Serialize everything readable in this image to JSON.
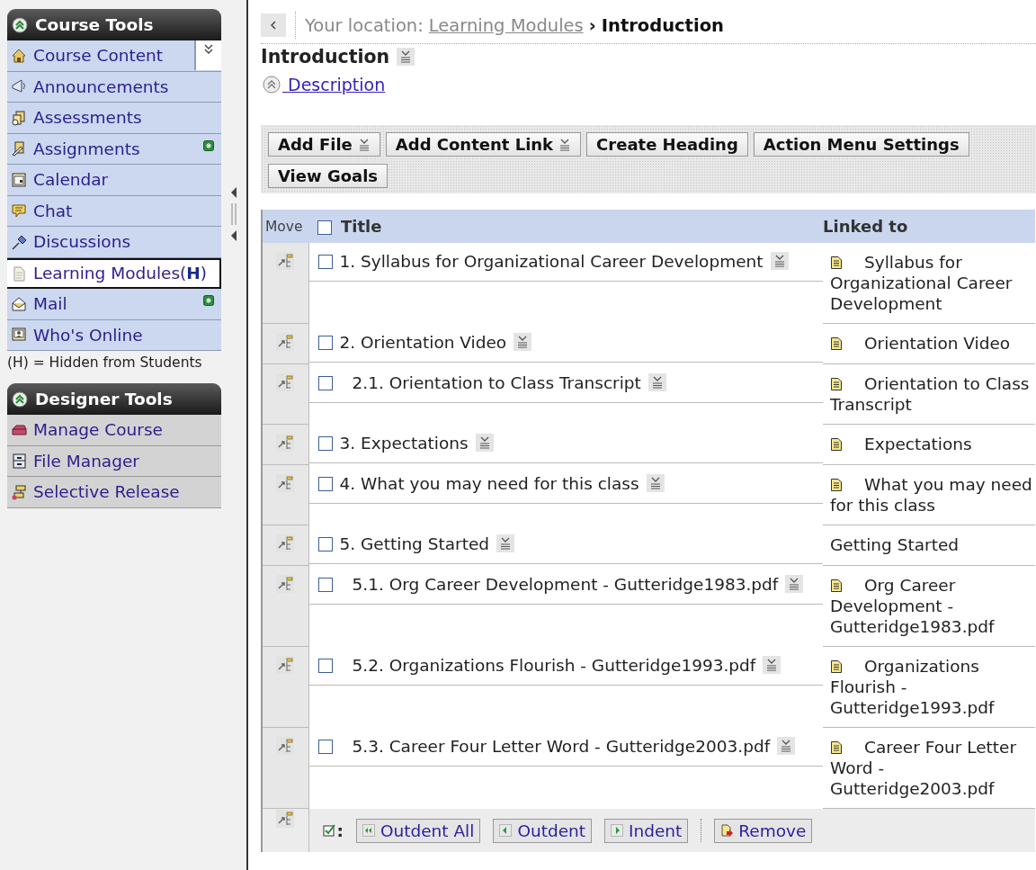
{
  "sidebar": {
    "sections": [
      {
        "title": "Course Tools",
        "expanded": true,
        "kind": "course",
        "items": [
          {
            "label": "Course Content",
            "selected": false,
            "new": false,
            "toggle": true
          },
          {
            "label": "Announcements",
            "selected": false,
            "new": false,
            "toggle": false
          },
          {
            "label": "Assessments",
            "selected": false,
            "new": false,
            "toggle": false
          },
          {
            "label": "Assignments",
            "selected": false,
            "new": true,
            "toggle": false
          },
          {
            "label": "Calendar",
            "selected": false,
            "new": false,
            "toggle": false
          },
          {
            "label": "Chat",
            "selected": false,
            "new": false,
            "toggle": false
          },
          {
            "label": "Discussions",
            "selected": false,
            "new": false,
            "toggle": false
          },
          {
            "label": "Learning Modules(**H**)",
            "selected": true,
            "new": false,
            "toggle": false
          },
          {
            "label": "Mail",
            "selected": false,
            "new": true,
            "toggle": false
          },
          {
            "label": "Who's Online",
            "selected": false,
            "new": false,
            "toggle": false
          }
        ],
        "legend": "(H) = Hidden from Students"
      },
      {
        "title": "Designer Tools",
        "expanded": true,
        "kind": "designer",
        "items": [
          {
            "label": "Manage Course",
            "selected": false,
            "new": false,
            "toggle": false
          },
          {
            "label": "File Manager",
            "selected": false,
            "new": false,
            "toggle": false
          },
          {
            "label": "Selective Release",
            "selected": false,
            "new": false,
            "toggle": false
          }
        ]
      }
    ]
  },
  "breadcrumb": {
    "prefix": "Your location:",
    "links": [
      "Learning Modules"
    ],
    "separator": "›",
    "current": "Introduction"
  },
  "page": {
    "title": "Introduction",
    "description": {
      "label": " Description",
      "expanded": true
    }
  },
  "toolbar": [
    {
      "label": "Add File",
      "menu": true
    },
    {
      "label": "Add Content Link",
      "menu": true
    },
    {
      "label": "Create Heading",
      "menu": false
    },
    {
      "label": "Action Menu Settings",
      "menu": false
    },
    {
      "label": "View Goals",
      "menu": false
    }
  ],
  "table": {
    "columns": [
      "Move",
      "Title",
      "Linked to"
    ],
    "select_all_checked": false,
    "rows": [
      {
        "title": "1. Syllabus for Organizational Career Development",
        "checked": false,
        "linked_to": "Syllabus for Organizational Career Development",
        "kind": "document"
      },
      {
        "title": "2. Orientation Video",
        "checked": false,
        "linked_to": "Orientation Video",
        "kind": "document",
        "children": [
          {
            "title": "2.1. Orientation to Class Transcript",
            "checked": false,
            "linked_to": "Orientation to Class Transcript",
            "kind": "document"
          }
        ]
      },
      {
        "title": "3. Expectations",
        "checked": false,
        "linked_to": "Expectations",
        "kind": "document"
      },
      {
        "title": "4. What you may need for this class",
        "checked": false,
        "linked_to": "What you may need for this class",
        "kind": "document"
      },
      {
        "title": "5. Getting Started",
        "checked": false,
        "linked_to": "Getting Started",
        "kind": "heading",
        "children": [
          {
            "title": "5.1. Org Career Development - Gutteridge1983.pdf",
            "checked": false,
            "linked_to": "Org Career Development - Gutteridge1983.pdf",
            "kind": "document"
          },
          {
            "title": "5.2. Organizations Flourish - Gutteridge1993.pdf",
            "checked": false,
            "linked_to": "Organizations Flourish - Gutteridge1993.pdf",
            "kind": "document"
          },
          {
            "title": "5.3. Career Four Letter Word - Gutteridge2003.pdf",
            "checked": false,
            "linked_to": "Career Four Letter Word - Gutteridge2003.pdf",
            "kind": "document"
          }
        ]
      }
    ],
    "footer": {
      "select_label": ":",
      "buttons": [
        {
          "label": "Outdent All",
          "kind": "outdent_all"
        },
        {
          "label": "Outdent",
          "kind": "outdent"
        },
        {
          "label": "Indent",
          "kind": "indent"
        },
        {
          "label": "Remove",
          "kind": "remove"
        }
      ]
    }
  }
}
